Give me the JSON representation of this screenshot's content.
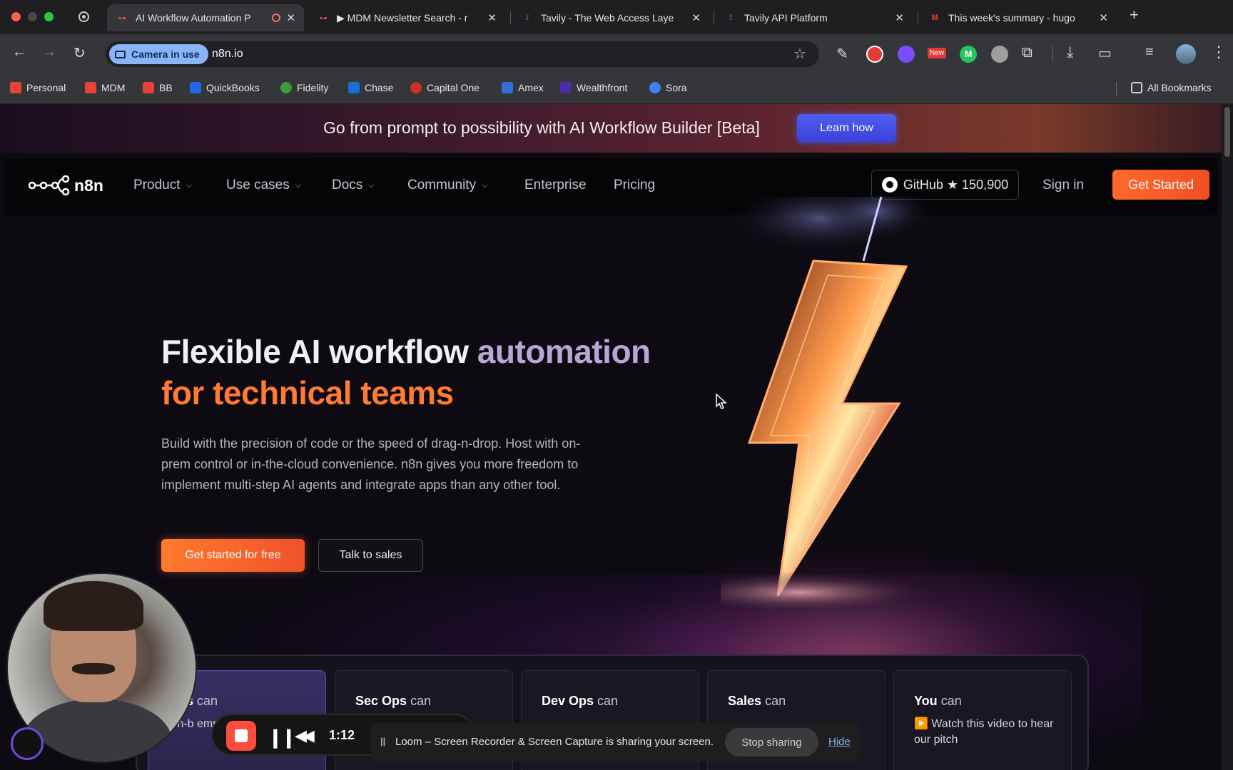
{
  "browser": {
    "tabs": [
      {
        "title": "AI Workflow Automation P",
        "active": true,
        "recording": true
      },
      {
        "title": "▶ MDM Newsletter Search - r",
        "active": false
      },
      {
        "title": "Tavily - The Web Access Laye",
        "active": false
      },
      {
        "title": "Tavily API Platform",
        "active": false
      },
      {
        "title": "This week's summary - hugo",
        "active": false
      }
    ],
    "camera_chip": "Camera in use",
    "url": "n8n.io",
    "new_badge": "New",
    "bookmarks": [
      "Personal",
      "MDM",
      "BB",
      "QuickBooks",
      "Fidelity",
      "Chase",
      "Capital One",
      "Amex",
      "Wealthfront",
      "Sora"
    ],
    "all_bookmarks": "All Bookmarks"
  },
  "banner": {
    "text": "Go from prompt to possibility with AI Workflow Builder [Beta]",
    "button": "Learn how"
  },
  "nav": {
    "logo": "n8n",
    "links": [
      "Product",
      "Use cases",
      "Docs",
      "Community",
      "Enterprise",
      "Pricing"
    ],
    "github": "GitHub ★ 150,900",
    "sign_in": "Sign in",
    "get_started": "Get Started"
  },
  "hero": {
    "title_line1_a": "Flexible AI workflow ",
    "title_line1_b": "automation",
    "title_line2": "for technical teams",
    "paragraph": "Build with the precision of code or the speed of drag-n-drop. Host with on-prem control or in-the-cloud convenience. n8n gives you more freedom to implement multi-step AI agents and integrate apps than any other tool.",
    "cta_primary": "Get started for free",
    "cta_secondary": "Talk to sales"
  },
  "cards": [
    {
      "role": "Ops",
      "suffix": "can",
      "text": "On-b employ"
    },
    {
      "role": "Sec Ops",
      "suffix": "can",
      "text": ""
    },
    {
      "role": "Dev Ops",
      "suffix": "can",
      "text": ""
    },
    {
      "role": "Sales",
      "suffix": "can",
      "text": ""
    },
    {
      "role": "You",
      "suffix": "can",
      "text": "▶️ Watch this video to hear our pitch"
    }
  ],
  "loom": {
    "timer": "1:12",
    "share_text": "Loom – Screen Recorder & Screen Capture is sharing your screen.",
    "stop_sharing": "Stop sharing",
    "hide": "Hide"
  },
  "colors": {
    "accent_orange": "#ff7a33",
    "banner_button": "#4f5ff0",
    "muted_purple": "#b9a6d6"
  }
}
